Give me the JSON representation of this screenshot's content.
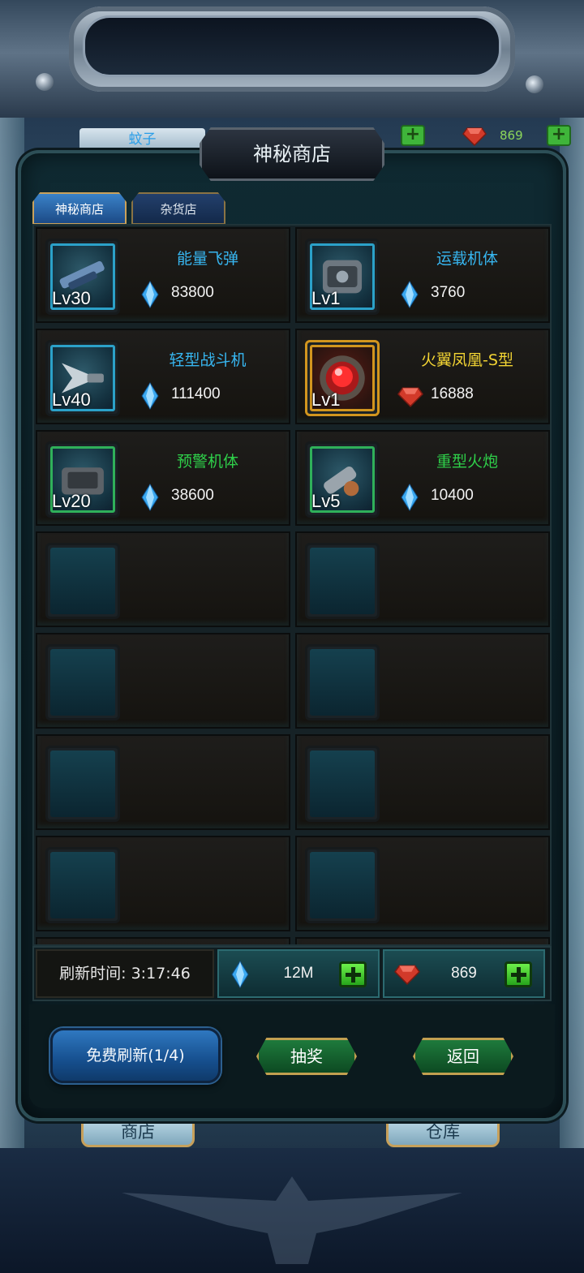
{
  "header": {
    "player_name": "蚊子",
    "gem_count": "869"
  },
  "panel": {
    "title": "神秘商店",
    "tabs": [
      {
        "label": "神秘商店",
        "active": true
      },
      {
        "label": "杂货店",
        "active": false
      }
    ]
  },
  "items": [
    {
      "name": "能量飞弹",
      "level": "Lv30",
      "price": "83800",
      "currency": "crystal",
      "name_color": "#37b6f0",
      "rarity": "blue"
    },
    {
      "name": "运载机体",
      "level": "Lv1",
      "price": "3760",
      "currency": "crystal",
      "name_color": "#37b6f0",
      "rarity": "blue"
    },
    {
      "name": "轻型战斗机",
      "level": "Lv40",
      "price": "111400",
      "currency": "crystal",
      "name_color": "#37b6f0",
      "rarity": "blue"
    },
    {
      "name": "火翼凤凰-S型",
      "level": "Lv1",
      "price": "16888",
      "currency": "ruby",
      "name_color": "#f2d433",
      "rarity": "gold"
    },
    {
      "name": "预警机体",
      "level": "Lv20",
      "price": "38600",
      "currency": "crystal",
      "name_color": "#2fd04a",
      "rarity": "green"
    },
    {
      "name": "重型火炮",
      "level": "Lv5",
      "price": "10400",
      "currency": "crystal",
      "name_color": "#2fd04a",
      "rarity": "green"
    }
  ],
  "footer": {
    "refresh_label": "刷新时间: 3:17:46",
    "crystal_amount": "12M",
    "ruby_amount": "869"
  },
  "actions": {
    "free_refresh": "免费刷新(1/4)",
    "lottery": "抽奖",
    "back": "返回"
  },
  "bottom_tabs": {
    "shop": "商店",
    "warehouse": "仓库"
  },
  "colors": {
    "crystal": "#3aa8f0",
    "ruby": "#d23a2a",
    "accent_green": "#3fe02a",
    "frame_gold": "#c9a15b"
  }
}
